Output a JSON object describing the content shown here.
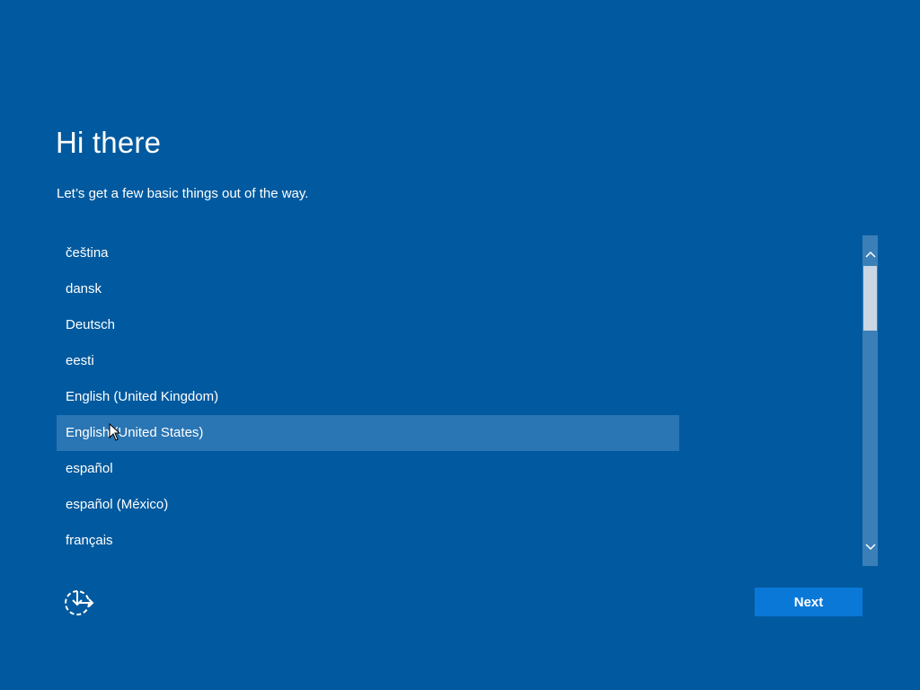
{
  "page": {
    "title": "Hi there",
    "subtitle": "Let’s get a few basic things out of the way."
  },
  "languages": {
    "items": [
      "čeština",
      "dansk",
      "Deutsch",
      "eesti",
      "English (United Kingdom)",
      "English (United States)",
      "español",
      "español (México)",
      "français"
    ],
    "selected_index": 5
  },
  "buttons": {
    "next_label": "Next"
  },
  "icons": {
    "ease_of_access": "ease-of-access-icon",
    "scroll_up": "chevron-up-icon",
    "scroll_down": "chevron-down-icon"
  },
  "colors": {
    "background": "#015a9f",
    "selected_row": "#2a75b3",
    "next_button": "#0a78d7",
    "scrollbar_track": "#3a7fb8",
    "scrollbar_thumb": "#c9d6e3"
  }
}
